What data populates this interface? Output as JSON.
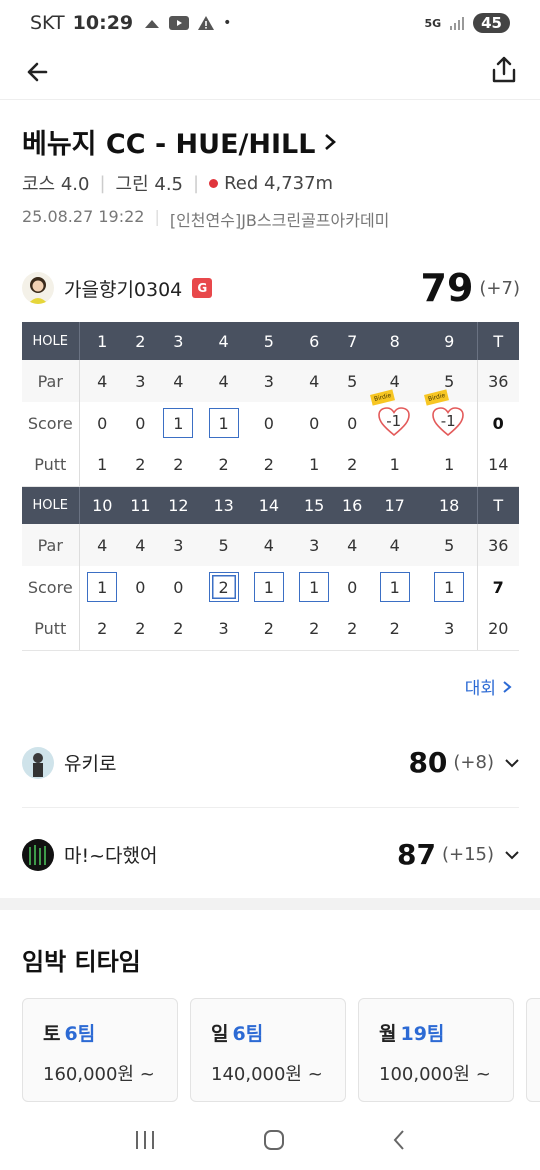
{
  "status": {
    "carrier": "SKT",
    "time": "10:29",
    "network": "5G",
    "battery": "45"
  },
  "course": {
    "title": "베뉴지 CC - HUE/HILL",
    "course_rating": "코스 4.0",
    "green_rating": "그린 4.5",
    "tee": "Red 4,737m",
    "datetime": "25.08.27 19:22",
    "location": "[인천연수]JB스크린골프아카데미"
  },
  "main_player": {
    "name": "가을향기0304",
    "badge": "G",
    "score": "79",
    "diff": "(+7)"
  },
  "scorecard": {
    "hole_label": "HOLE",
    "par_label": "Par",
    "score_label": "Score",
    "putt_label": "Putt",
    "total_label": "T",
    "front": {
      "holes": [
        "1",
        "2",
        "3",
        "4",
        "5",
        "6",
        "7",
        "8",
        "9"
      ],
      "par": [
        "4",
        "3",
        "4",
        "4",
        "3",
        "4",
        "5",
        "4",
        "5"
      ],
      "par_total": "36",
      "score": [
        "0",
        "0",
        "1",
        "1",
        "0",
        "0",
        "0",
        "-1",
        "-1"
      ],
      "score_total": "0",
      "putt": [
        "1",
        "2",
        "2",
        "2",
        "2",
        "1",
        "2",
        "1",
        "1"
      ],
      "putt_total": "14"
    },
    "back": {
      "holes": [
        "10",
        "11",
        "12",
        "13",
        "14",
        "15",
        "16",
        "17",
        "18"
      ],
      "par": [
        "4",
        "4",
        "3",
        "5",
        "4",
        "3",
        "4",
        "4",
        "5"
      ],
      "par_total": "36",
      "score": [
        "1",
        "0",
        "0",
        "2",
        "1",
        "1",
        "0",
        "1",
        "1"
      ],
      "score_total": "7",
      "putt": [
        "2",
        "2",
        "2",
        "3",
        "2",
        "2",
        "2",
        "2",
        "3"
      ],
      "putt_total": "20"
    },
    "birdie_tag": "Birdie"
  },
  "more_link": "대회",
  "other_players": [
    {
      "name": "유키로",
      "score": "80",
      "diff": "(+8)"
    },
    {
      "name": "마!~다했어",
      "score": "87",
      "diff": "(+15)"
    }
  ],
  "tee_section": {
    "title": "임박 티타임",
    "cards": [
      {
        "day": "토",
        "teams": "6팀",
        "price": "160,000원 ~"
      },
      {
        "day": "일",
        "teams": "6팀",
        "price": "140,000원 ~"
      },
      {
        "day": "월",
        "teams": "19팀",
        "price": "100,000원 ~"
      }
    ]
  },
  "colors": {
    "accent": "#2c6ad4",
    "header": "#495160",
    "red": "#e0353c",
    "badge": "#e8484b"
  }
}
